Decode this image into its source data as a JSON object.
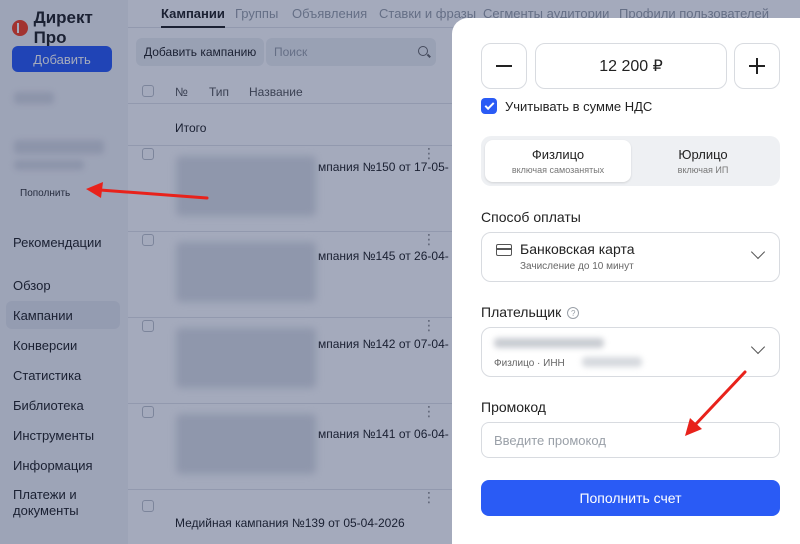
{
  "app": {
    "logo": "Директ Про",
    "add_button": "Добавить",
    "refill_link": "Пополнить"
  },
  "sidebar": {
    "items": [
      {
        "label": "Рекомендации"
      },
      {
        "label": "Обзор"
      },
      {
        "label": "Кампании",
        "active": true
      },
      {
        "label": "Конверсии"
      },
      {
        "label": "Статистика"
      },
      {
        "label": "Библиотека"
      },
      {
        "label": "Инструменты"
      },
      {
        "label": "Информация"
      },
      {
        "label": "Платежи и документы"
      }
    ]
  },
  "main": {
    "tabs": [
      "Кампании",
      "Группы",
      "Объявления",
      "Ставки и фразы",
      "Сегменты аудитории",
      "Профили пользователей"
    ],
    "toolbar": {
      "add_campaign": "Добавить кампанию",
      "search_placeholder": "Поиск"
    },
    "table": {
      "headers": [
        "№",
        "Тип",
        "Название"
      ],
      "total_label": "Итого",
      "rows": [
        {
          "name": "мпания №150 от 17-05-"
        },
        {
          "name": "мпания №145 от 26-04-"
        },
        {
          "name": "мпания №142 от 07-04-"
        },
        {
          "name": "мпания №141 от 06-04-"
        }
      ],
      "last_row": "Медийная кампания №139 от 05-04-2026"
    }
  },
  "payment": {
    "amount": "12 200 ₽",
    "vat_label": "Учитывать в сумме НДС",
    "vat_checked": true,
    "payer_types": [
      {
        "title": "Физлицо",
        "subtitle": "включая самозанятых",
        "selected": true
      },
      {
        "title": "Юрлицо",
        "subtitle": "включая ИП",
        "selected": false
      }
    ],
    "method_label": "Способ оплаты",
    "method": {
      "title": "Банковская карта",
      "subtitle": "Зачисление до 10 минут"
    },
    "payer_label": "Плательщик",
    "payer_sub": "Физлицо  ·  ИНН",
    "promo_label": "Промокод",
    "promo_placeholder": "Введите промокод",
    "submit": "Пополнить счет"
  },
  "colors": {
    "accent": "#2a5bf5",
    "annotation": "#e8221b"
  }
}
